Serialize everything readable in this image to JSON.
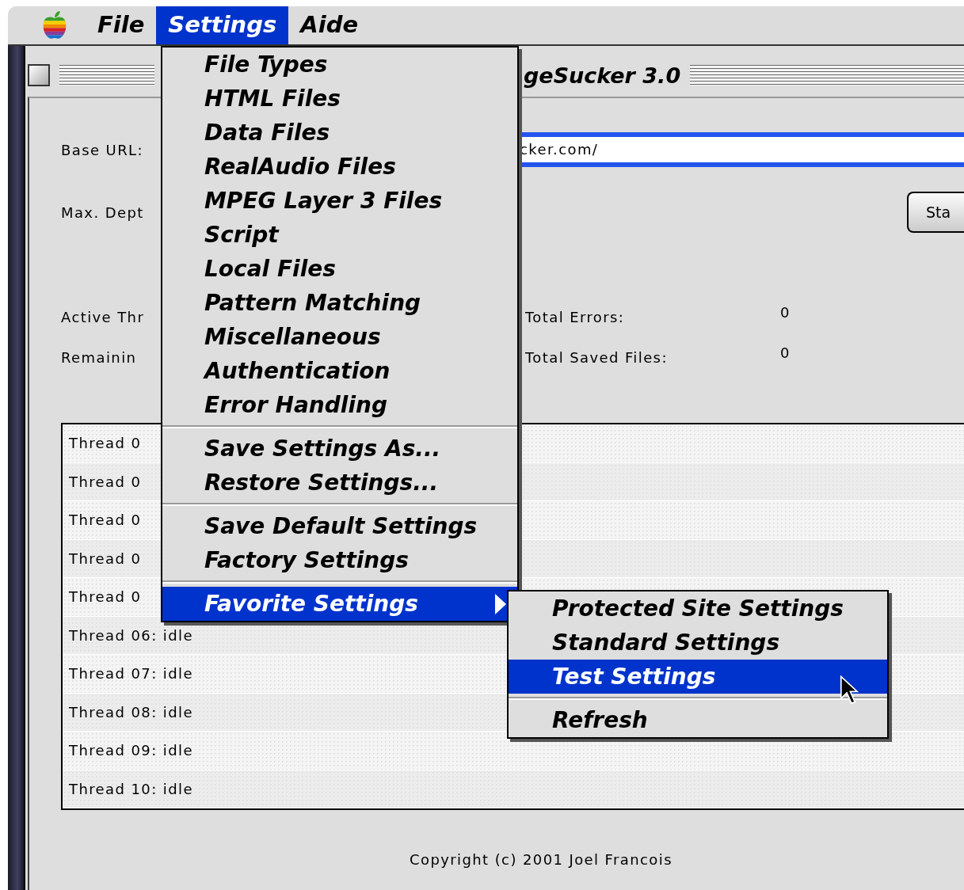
{
  "menu_bar": {
    "items": [
      {
        "label": "File",
        "selected": false
      },
      {
        "label": "Settings",
        "selected": true
      },
      {
        "label": "Aide",
        "selected": false
      }
    ]
  },
  "settings_menu": {
    "items": [
      {
        "kind": "item",
        "label": "File Types",
        "selected": false,
        "has_submenu": false
      },
      {
        "kind": "item",
        "label": "HTML Files",
        "selected": false,
        "has_submenu": false
      },
      {
        "kind": "item",
        "label": "Data Files",
        "selected": false,
        "has_submenu": false
      },
      {
        "kind": "item",
        "label": "RealAudio Files",
        "selected": false,
        "has_submenu": false
      },
      {
        "kind": "item",
        "label": "MPEG Layer 3 Files",
        "selected": false,
        "has_submenu": false
      },
      {
        "kind": "item",
        "label": "Script",
        "selected": false,
        "has_submenu": false
      },
      {
        "kind": "item",
        "label": "Local Files",
        "selected": false,
        "has_submenu": false
      },
      {
        "kind": "item",
        "label": "Pattern Matching",
        "selected": false,
        "has_submenu": false
      },
      {
        "kind": "item",
        "label": "Miscellaneous",
        "selected": false,
        "has_submenu": false
      },
      {
        "kind": "item",
        "label": "Authentication",
        "selected": false,
        "has_submenu": false
      },
      {
        "kind": "item",
        "label": "Error Handling",
        "selected": false,
        "has_submenu": false
      },
      {
        "kind": "separator"
      },
      {
        "kind": "item",
        "label": "Save Settings As...",
        "selected": false,
        "has_submenu": false
      },
      {
        "kind": "item",
        "label": "Restore Settings...",
        "selected": false,
        "has_submenu": false
      },
      {
        "kind": "separator"
      },
      {
        "kind": "item",
        "label": "Save Default Settings",
        "selected": false,
        "has_submenu": false
      },
      {
        "kind": "item",
        "label": "Factory Settings",
        "selected": false,
        "has_submenu": false
      },
      {
        "kind": "separator"
      },
      {
        "kind": "item",
        "label": "Favorite Settings",
        "selected": true,
        "has_submenu": true
      }
    ]
  },
  "favorite_submenu": {
    "items": [
      {
        "kind": "item",
        "label": "Protected Site Settings",
        "selected": false
      },
      {
        "kind": "item",
        "label": "Standard Settings",
        "selected": false
      },
      {
        "kind": "item",
        "label": "Test Settings",
        "selected": true
      },
      {
        "kind": "separator"
      },
      {
        "kind": "item",
        "label": "Refresh",
        "selected": false
      }
    ]
  },
  "window": {
    "title": "geSucker 3.0",
    "base_url": {
      "label": "Base URL:",
      "value": "cker.com/",
      "focused": true
    },
    "max_depth": {
      "label": "Max. Dept"
    },
    "start_button": "Sta",
    "stats_left": [
      {
        "label": "Active Thr"
      },
      {
        "label": "Remainin"
      }
    ],
    "stats_right": [
      {
        "label": "Total Errors:",
        "value": "0"
      },
      {
        "label": "Total Saved Files:",
        "value": "0"
      }
    ],
    "threads": [
      "Thread 0",
      "Thread 0",
      "Thread 0",
      "Thread 0",
      "Thread 0",
      "Thread 06: idle",
      "Thread 07: idle",
      "Thread 08: idle",
      "Thread 09: idle",
      "Thread 10: idle"
    ],
    "copyright": "Copyright (c) 2001 Joel Francois"
  }
}
